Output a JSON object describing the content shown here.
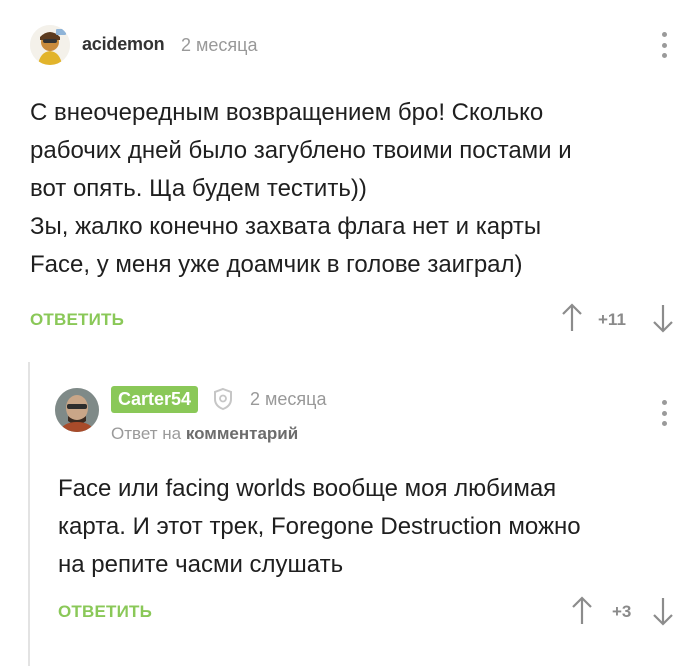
{
  "comments": [
    {
      "author": "acidemon",
      "time": "2 месяца",
      "lines": [
        "С внеочередным возвращением бро! Сколько",
        "рабочих дней было загублено твоими постами и",
        "вот опять. Ща будем тестить))",
        "Зы, жалко конечно захвата флага нет и карты",
        "Face, у меня уже доамчик в голове заиграл)"
      ],
      "reply_label": "ОТВЕТИТЬ",
      "score": "+11"
    },
    {
      "author": "Carter54",
      "time": "2 месяца",
      "reply_to_prefix": "Ответ на",
      "reply_to_target": "комментарий",
      "lines": [
        "Face или facing worlds вообще моя любимая",
        "карта. И этот трек, Foregone Destruction можно",
        "на репите часми слушать"
      ],
      "reply_label": "ОТВЕТИТЬ",
      "score": "+3"
    }
  ],
  "colors": {
    "accent": "#8ac858",
    "muted": "#999999",
    "text": "#1f1f1f"
  },
  "icons": {
    "menu": "kebab-icon",
    "upvote": "arrow-up-icon",
    "downvote": "arrow-down-icon",
    "shield": "shield-icon"
  }
}
